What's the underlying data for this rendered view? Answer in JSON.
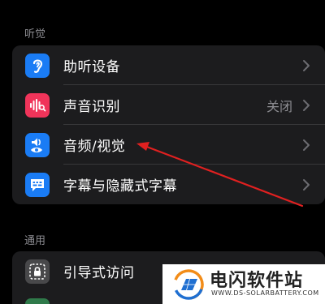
{
  "sections": {
    "hearing_header": "听觉",
    "general_header": "通用"
  },
  "hearing_items": [
    {
      "label": "助听设备",
      "value": "",
      "icon": "ear-icon",
      "icon_bg": "#1a7cf5"
    },
    {
      "label": "声音识别",
      "value": "关闭",
      "icon": "sound-recognition-icon",
      "icon_bg": "#f0345a"
    },
    {
      "label": "音频/视觉",
      "value": "",
      "icon": "audio-visual-icon",
      "icon_bg": "#1a7cf5"
    },
    {
      "label": "字幕与隐藏式字幕",
      "value": "",
      "icon": "captions-icon",
      "icon_bg": "#1a7cf5"
    }
  ],
  "general_items": [
    {
      "label": "引导式访问",
      "value": "",
      "icon": "guided-access-icon",
      "icon_bg": "#48484a"
    }
  ],
  "watermark": {
    "title": "电闪软件站",
    "subtitle": "WWW.DS-SOLARBATTERY.COM"
  },
  "colors": {
    "background": "#000000",
    "cell": "#1c1c1e",
    "accent_blue": "#1a7cf5",
    "accent_red": "#f0345a",
    "annotation_arrow": "#e02020"
  }
}
